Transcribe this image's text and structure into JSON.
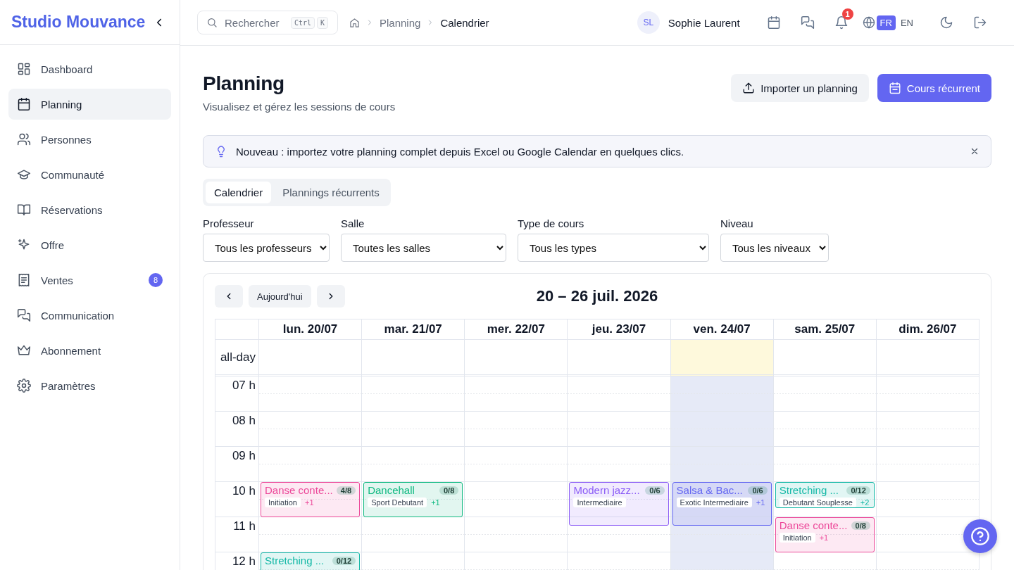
{
  "sidebar": {
    "brand": "Studio Mouvance",
    "items": [
      {
        "label": "Dashboard",
        "selected": false
      },
      {
        "label": "Planning",
        "selected": true
      },
      {
        "label": "Personnes",
        "selected": false
      },
      {
        "label": "Communauté",
        "selected": false
      },
      {
        "label": "Réservations",
        "selected": false
      },
      {
        "label": "Offre",
        "selected": false
      },
      {
        "label": "Ventes",
        "selected": false,
        "badge": "8"
      },
      {
        "label": "Communication",
        "selected": false
      },
      {
        "label": "Abonnement",
        "selected": false
      },
      {
        "label": "Paramètres",
        "selected": false
      }
    ]
  },
  "topbar": {
    "search": {
      "placeholder": "Rechercher",
      "shortcut": [
        "Ctrl",
        "K"
      ]
    },
    "breadcrumb": [
      {
        "label": "Planning",
        "current": false
      },
      {
        "label": "Calendrier",
        "current": true
      }
    ],
    "user": {
      "initials": "SL",
      "name": "Sophie Laurent"
    },
    "notifications": "1",
    "languages": [
      {
        "label": "FR",
        "selected": true
      },
      {
        "label": "EN",
        "selected": false
      }
    ]
  },
  "header": {
    "title": "Planning",
    "subtitle": "Visualisez et gérez les sessions de cours",
    "buttons": [
      {
        "label": "Importer un planning",
        "kind": "secondary"
      },
      {
        "label": "Cours récurrent",
        "kind": "primary"
      }
    ]
  },
  "banner": {
    "text": "Nouveau : importez votre planning complet depuis Excel ou Google Calendar en quelques clics."
  },
  "tabs": [
    {
      "label": "Calendrier",
      "selected": true
    },
    {
      "label": "Plannings récurrents",
      "selected": false
    }
  ],
  "filters": [
    {
      "label": "Professeur",
      "value": "Tous les professeurs"
    },
    {
      "label": "Salle",
      "value": "Toutes les salles"
    },
    {
      "label": "Type de cours",
      "value": "Tous les types"
    },
    {
      "label": "Niveau",
      "value": "Tous les niveaux"
    }
  ],
  "calendar": {
    "today_button": "Aujourd'hui",
    "title": "20 – 26 juil. 2026",
    "allday_label": "all-day",
    "days": [
      {
        "label": "lun. 20/07",
        "today": false
      },
      {
        "label": "mar. 21/07",
        "today": false
      },
      {
        "label": "mer. 22/07",
        "today": false
      },
      {
        "label": "jeu. 23/07",
        "today": false
      },
      {
        "label": "ven. 24/07",
        "today": true
      },
      {
        "label": "sam. 25/07",
        "today": false
      },
      {
        "label": "dim. 26/07",
        "today": false
      }
    ],
    "rows": [
      {
        "label": "07 h",
        "cells": [
          {
            "today": false
          },
          {
            "today": false
          },
          {
            "today": false
          },
          {
            "today": false
          },
          {
            "today": true
          },
          {
            "today": false
          },
          {
            "today": false
          }
        ]
      },
      {
        "label": "08 h",
        "cells": [
          {
            "today": false
          },
          {
            "today": false
          },
          {
            "today": false
          },
          {
            "today": false
          },
          {
            "today": true
          },
          {
            "today": false
          },
          {
            "today": false
          }
        ]
      },
      {
        "label": "09 h",
        "cells": [
          {
            "today": false
          },
          {
            "today": false
          },
          {
            "today": false
          },
          {
            "today": false
          },
          {
            "today": true
          },
          {
            "today": false
          },
          {
            "today": false
          }
        ]
      },
      {
        "label": "10 h",
        "cells": [
          {
            "today": false,
            "event": {
              "title": "Danse conte...",
              "count": "4/8",
              "tag": "Initiation",
              "more": "+1",
              "color": "#ec4899",
              "kind": "hour"
            }
          },
          {
            "today": false,
            "event": {
              "title": "Dancehall",
              "count": "0/8",
              "tag": "Sport Debutant",
              "more": "+1",
              "color": "#10b981",
              "kind": "hour"
            }
          },
          {
            "today": false
          },
          {
            "today": false,
            "event": {
              "title": "Modern jazz...",
              "count": "0/6",
              "tag": "Intermediaire",
              "color": "#8b5cf6",
              "kind": "long"
            }
          },
          {
            "today": true,
            "event": {
              "title": "Salsa & Bac...",
              "count": "0/6",
              "tag": "Exotic Intermediaire",
              "more": "+1",
              "color": "#6366f1",
              "kind": "long"
            }
          },
          {
            "today": false,
            "event": {
              "title": "Stretching ...",
              "count": "0/12",
              "tag": "Debutant Souplesse",
              "more": "+2",
              "color": "#14b8a6",
              "kind": "short"
            }
          },
          {
            "today": false
          }
        ]
      },
      {
        "label": "11 h",
        "cells": [
          {
            "today": false
          },
          {
            "today": false
          },
          {
            "today": false
          },
          {
            "today": false
          },
          {
            "today": true
          },
          {
            "today": false,
            "event": {
              "title": "Danse conte...",
              "count": "0/8",
              "tag": "Initiation",
              "more": "+1",
              "color": "#ec4899",
              "kind": "hour"
            }
          },
          {
            "today": false
          }
        ]
      },
      {
        "label": "12 h",
        "cells": [
          {
            "today": false,
            "event": {
              "title": "Stretching ...",
              "count": "0/12",
              "color": "#14b8a6",
              "kind": "hour"
            }
          },
          {
            "today": false
          },
          {
            "today": false
          },
          {
            "today": false
          },
          {
            "today": true
          },
          {
            "today": false
          },
          {
            "today": false
          }
        ]
      }
    ]
  }
}
